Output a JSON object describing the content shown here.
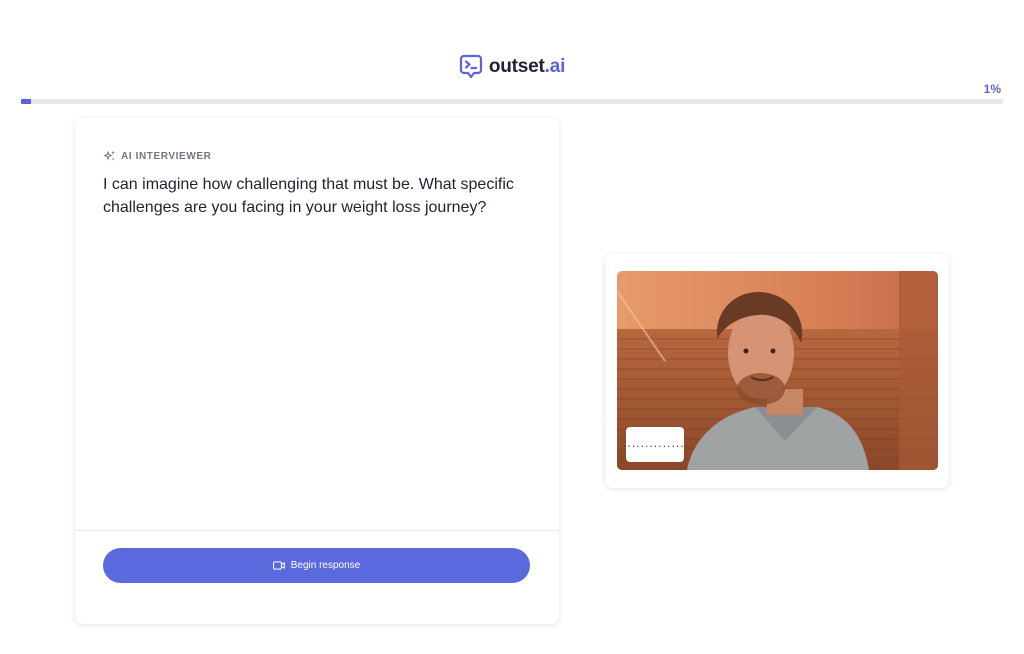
{
  "header": {
    "brand_main": "outset",
    "brand_suffix": ".ai",
    "logo_icon": "chat-terminal-icon"
  },
  "progress": {
    "label": "1%",
    "value": 0.01
  },
  "interviewer": {
    "label": "AI INTERVIEWER",
    "label_icon": "sparkle-icon",
    "question": "I can imagine how challenging that must be. What specific challenges are you facing in your weight loss journey?",
    "begin_button_label": "Begin response",
    "begin_button_icon": "video-camera-icon"
  },
  "video": {
    "audio_level_text": "..............."
  },
  "colors": {
    "accent": "#5b63dd",
    "button": "#5b69df",
    "text": "#1f2233",
    "muted": "#737585"
  }
}
